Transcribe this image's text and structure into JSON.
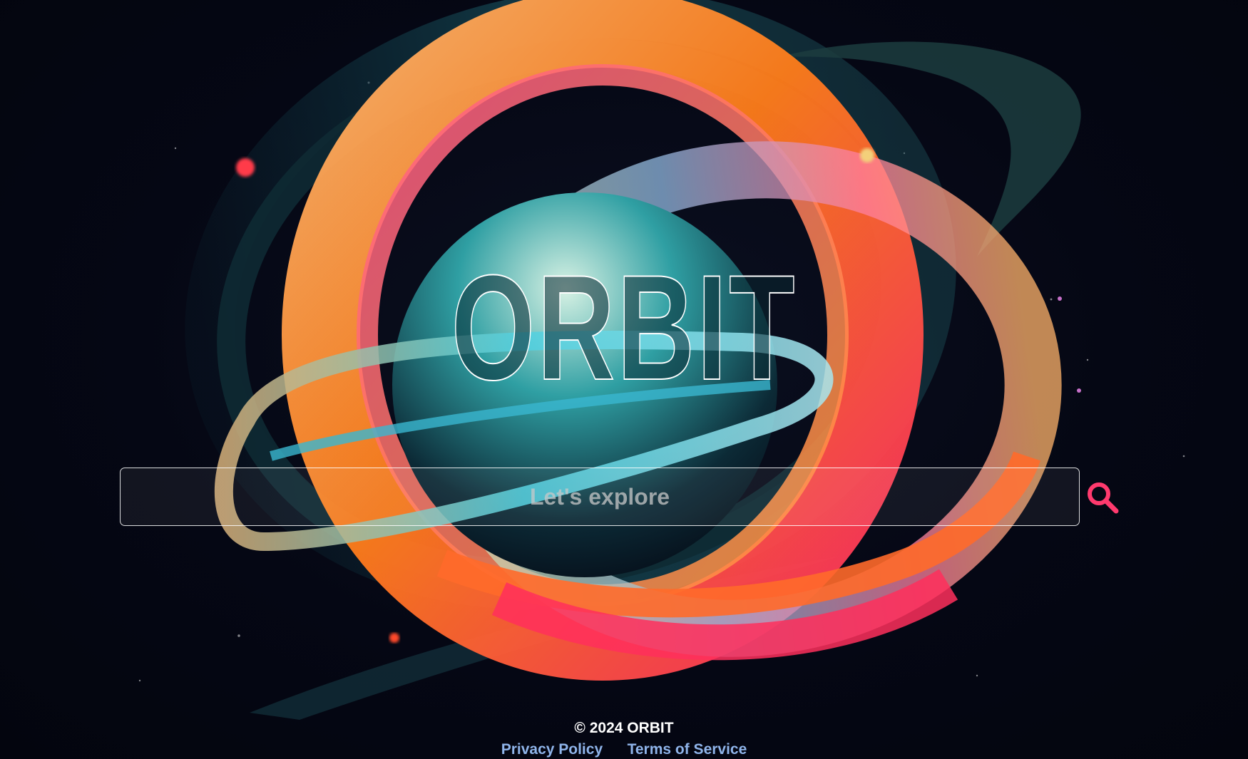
{
  "brand": {
    "logo_text": "ORBIT"
  },
  "search": {
    "placeholder": "Let's explore",
    "value": "",
    "icon": "search-icon"
  },
  "footer": {
    "copyright": "© 2024 ORBIT",
    "links": [
      {
        "label": "Privacy Policy"
      },
      {
        "label": "Terms of Service"
      }
    ]
  },
  "colors": {
    "background": "#050714",
    "search_icon": "#ff3a6e",
    "link": "#8fb4ea",
    "text": "#ffffff"
  }
}
